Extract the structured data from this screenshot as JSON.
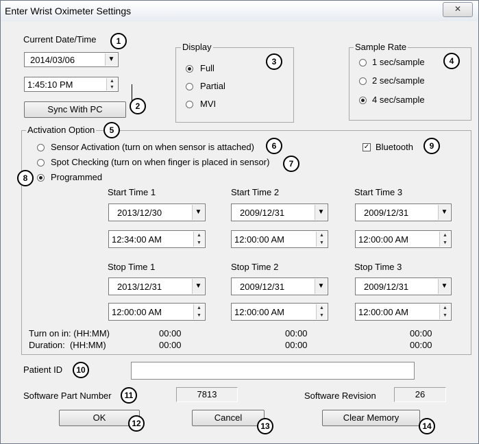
{
  "window": {
    "title": "Enter Wrist Oximeter Settings",
    "close_glyph": "✕"
  },
  "current": {
    "label": "Current Date/Time",
    "date": "2014/03/06",
    "time": "1:45:10 PM",
    "sync_label": "Sync With PC"
  },
  "display": {
    "label": "Display",
    "options": [
      "Full",
      "Partial",
      "MVI"
    ],
    "selected": "Full"
  },
  "sample_rate": {
    "label": "Sample Rate",
    "options": [
      "1 sec/sample",
      "2 sec/sample",
      "4 sec/sample"
    ],
    "selected": "4 sec/sample"
  },
  "activation": {
    "label": "Activation Option",
    "options": [
      "Sensor Activation (turn on when sensor is attached)",
      "Spot Checking (turn on when finger is placed in sensor)",
      "Programmed"
    ],
    "selected": "Programmed",
    "bluetooth_label": "Bluetooth",
    "bluetooth_checked": true,
    "start": [
      {
        "label": "Start Time 1",
        "date": "2013/12/30",
        "time": "12:34:00 AM"
      },
      {
        "label": "Start Time 2",
        "date": "2009/12/31",
        "time": "12:00:00 AM"
      },
      {
        "label": "Start Time 3",
        "date": "2009/12/31",
        "time": "12:00:00 AM"
      }
    ],
    "stop": [
      {
        "label": "Stop Time 1",
        "date": "2013/12/31",
        "time": "12:00:00 AM"
      },
      {
        "label": "Stop Time 2",
        "date": "2009/12/31",
        "time": "12:00:00 AM"
      },
      {
        "label": "Stop Time 3",
        "date": "2009/12/31",
        "time": "12:00:00 AM"
      }
    ],
    "turn_on_label": "Turn on in: (HH:MM)",
    "duration_label": "Duration:  (HH:MM)",
    "turn_on_values": [
      "00:00",
      "00:00",
      "00:00"
    ],
    "duration_values": [
      "00:00",
      "00:00",
      "00:00"
    ]
  },
  "patient": {
    "label": "Patient ID",
    "value": ""
  },
  "software": {
    "part_label": "Software Part Number",
    "part_value": "7813",
    "revision_label": "Software Revision",
    "revision_value": "26"
  },
  "buttons": {
    "ok": "OK",
    "cancel": "Cancel",
    "clear": "Clear Memory"
  },
  "callouts": [
    "1",
    "2",
    "3",
    "4",
    "5",
    "6",
    "7",
    "8",
    "9",
    "10",
    "11",
    "12",
    "13",
    "14"
  ]
}
